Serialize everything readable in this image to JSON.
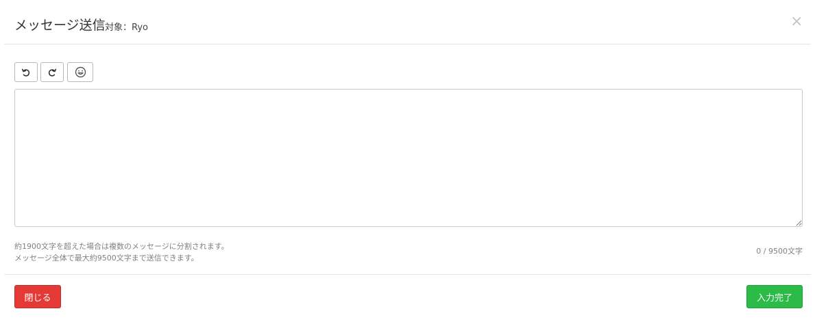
{
  "header": {
    "title": "メッセージ送信",
    "subtitle": "対象：Ryo",
    "close_symbol": "×"
  },
  "toolbar": {
    "undo_icon": "undo-icon",
    "redo_icon": "redo-icon",
    "emoji_icon": "emoji-icon"
  },
  "editor": {
    "value": ""
  },
  "notes": {
    "line1": "約1900文字を超えた場合は複数のメッセージに分割されます。",
    "line2": "メッセージ全体で最大約9500文字まで送信できます。"
  },
  "counter": {
    "text": "0 / 9500文字"
  },
  "footer": {
    "close_label": "閉じる",
    "done_label": "入力完了",
    "close_color": "#e53935",
    "done_color": "#2dbb48"
  }
}
